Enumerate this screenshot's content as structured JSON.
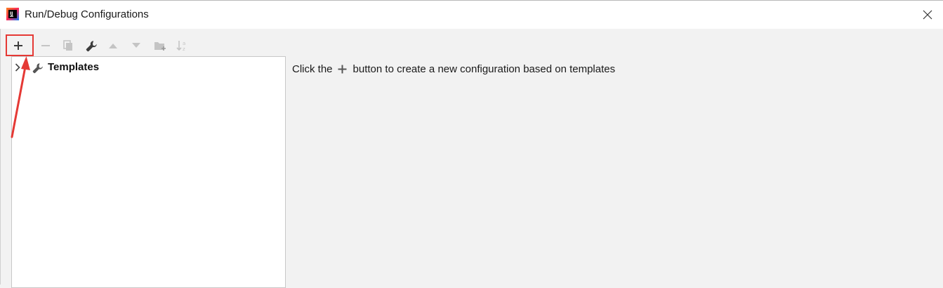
{
  "window": {
    "title": "Run/Debug Configurations",
    "app_icon": "intellij-idea-icon",
    "close_icon": "close-icon"
  },
  "toolbar": {
    "buttons": [
      {
        "name": "add-button",
        "icon": "plus-icon",
        "enabled": true
      },
      {
        "name": "remove-button",
        "icon": "minus-icon",
        "enabled": false
      },
      {
        "name": "copy-button",
        "icon": "copy-icon",
        "enabled": false
      },
      {
        "name": "edit-templates-button",
        "icon": "wrench-icon",
        "enabled": true
      },
      {
        "name": "move-up-button",
        "icon": "triangle-up-icon",
        "enabled": false
      },
      {
        "name": "move-down-button",
        "icon": "triangle-down-icon",
        "enabled": false
      },
      {
        "name": "new-folder-button",
        "icon": "folder-add-icon",
        "enabled": false
      },
      {
        "name": "sort-button",
        "icon": "sort-az-icon",
        "enabled": false
      }
    ]
  },
  "tree": {
    "items": [
      {
        "label": "Templates",
        "icon": "wrench-icon",
        "expanded": false
      }
    ]
  },
  "main": {
    "hint_before": "Click the",
    "hint_after": "button to create a new configuration based on templates"
  },
  "annotation": {
    "color": "#e53935"
  }
}
